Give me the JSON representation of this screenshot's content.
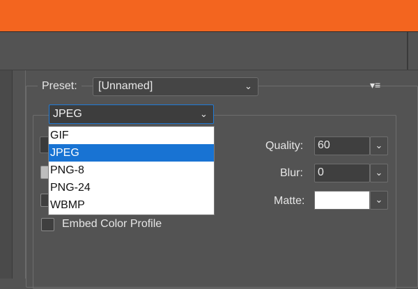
{
  "preset": {
    "label": "Preset:",
    "value": "[Unnamed]",
    "menu_icon": "flyout-menu-icon"
  },
  "format_select": {
    "value": "JPEG",
    "options": [
      "GIF",
      "JPEG",
      "PNG-8",
      "PNG-24",
      "WBMP"
    ],
    "selected_index": 1
  },
  "settings": {
    "quality_label": "Quality:",
    "quality_value": "60",
    "blur_label": "Blur:",
    "blur_value": "0",
    "matte_label": "Matte:",
    "matte_color": "#ffffff"
  },
  "embed_profile": {
    "label": "Embed Color Profile",
    "checked": false
  },
  "colors": {
    "titlebar": "#f3651f",
    "panel": "#535353",
    "selection": "#1873d3"
  }
}
